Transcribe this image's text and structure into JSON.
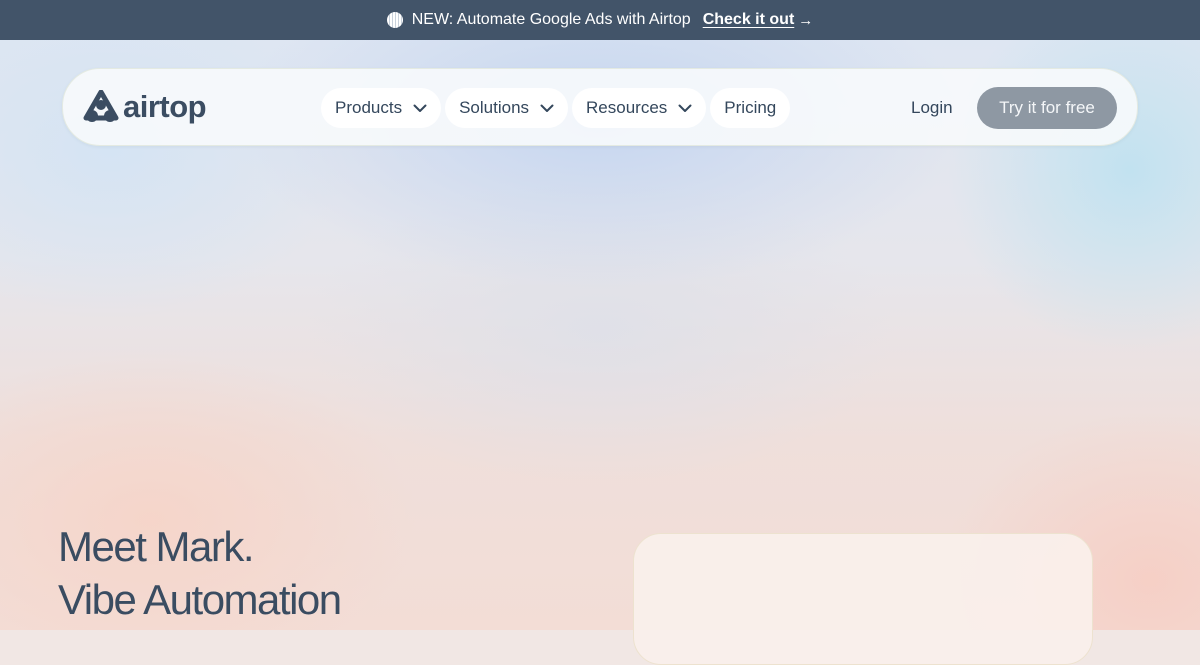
{
  "announcement": {
    "icon": "disc-icon",
    "text": "NEW: Automate Google Ads with Airtop",
    "link_label": "Check it out",
    "arrow": "→"
  },
  "nav": {
    "logo_text": "airtop",
    "items": [
      {
        "label": "Products",
        "has_dropdown": true
      },
      {
        "label": "Solutions",
        "has_dropdown": true
      },
      {
        "label": "Resources",
        "has_dropdown": true
      },
      {
        "label": "Pricing",
        "has_dropdown": false
      }
    ],
    "login_label": "Login",
    "cta_label": "Try it for free"
  },
  "hero": {
    "line1": "Meet Mark.",
    "line2": "Vibe Automation"
  },
  "colors": {
    "announcement_bg": "#425469",
    "text_primary": "#34475c",
    "cta_bg": "#8e98a3"
  }
}
